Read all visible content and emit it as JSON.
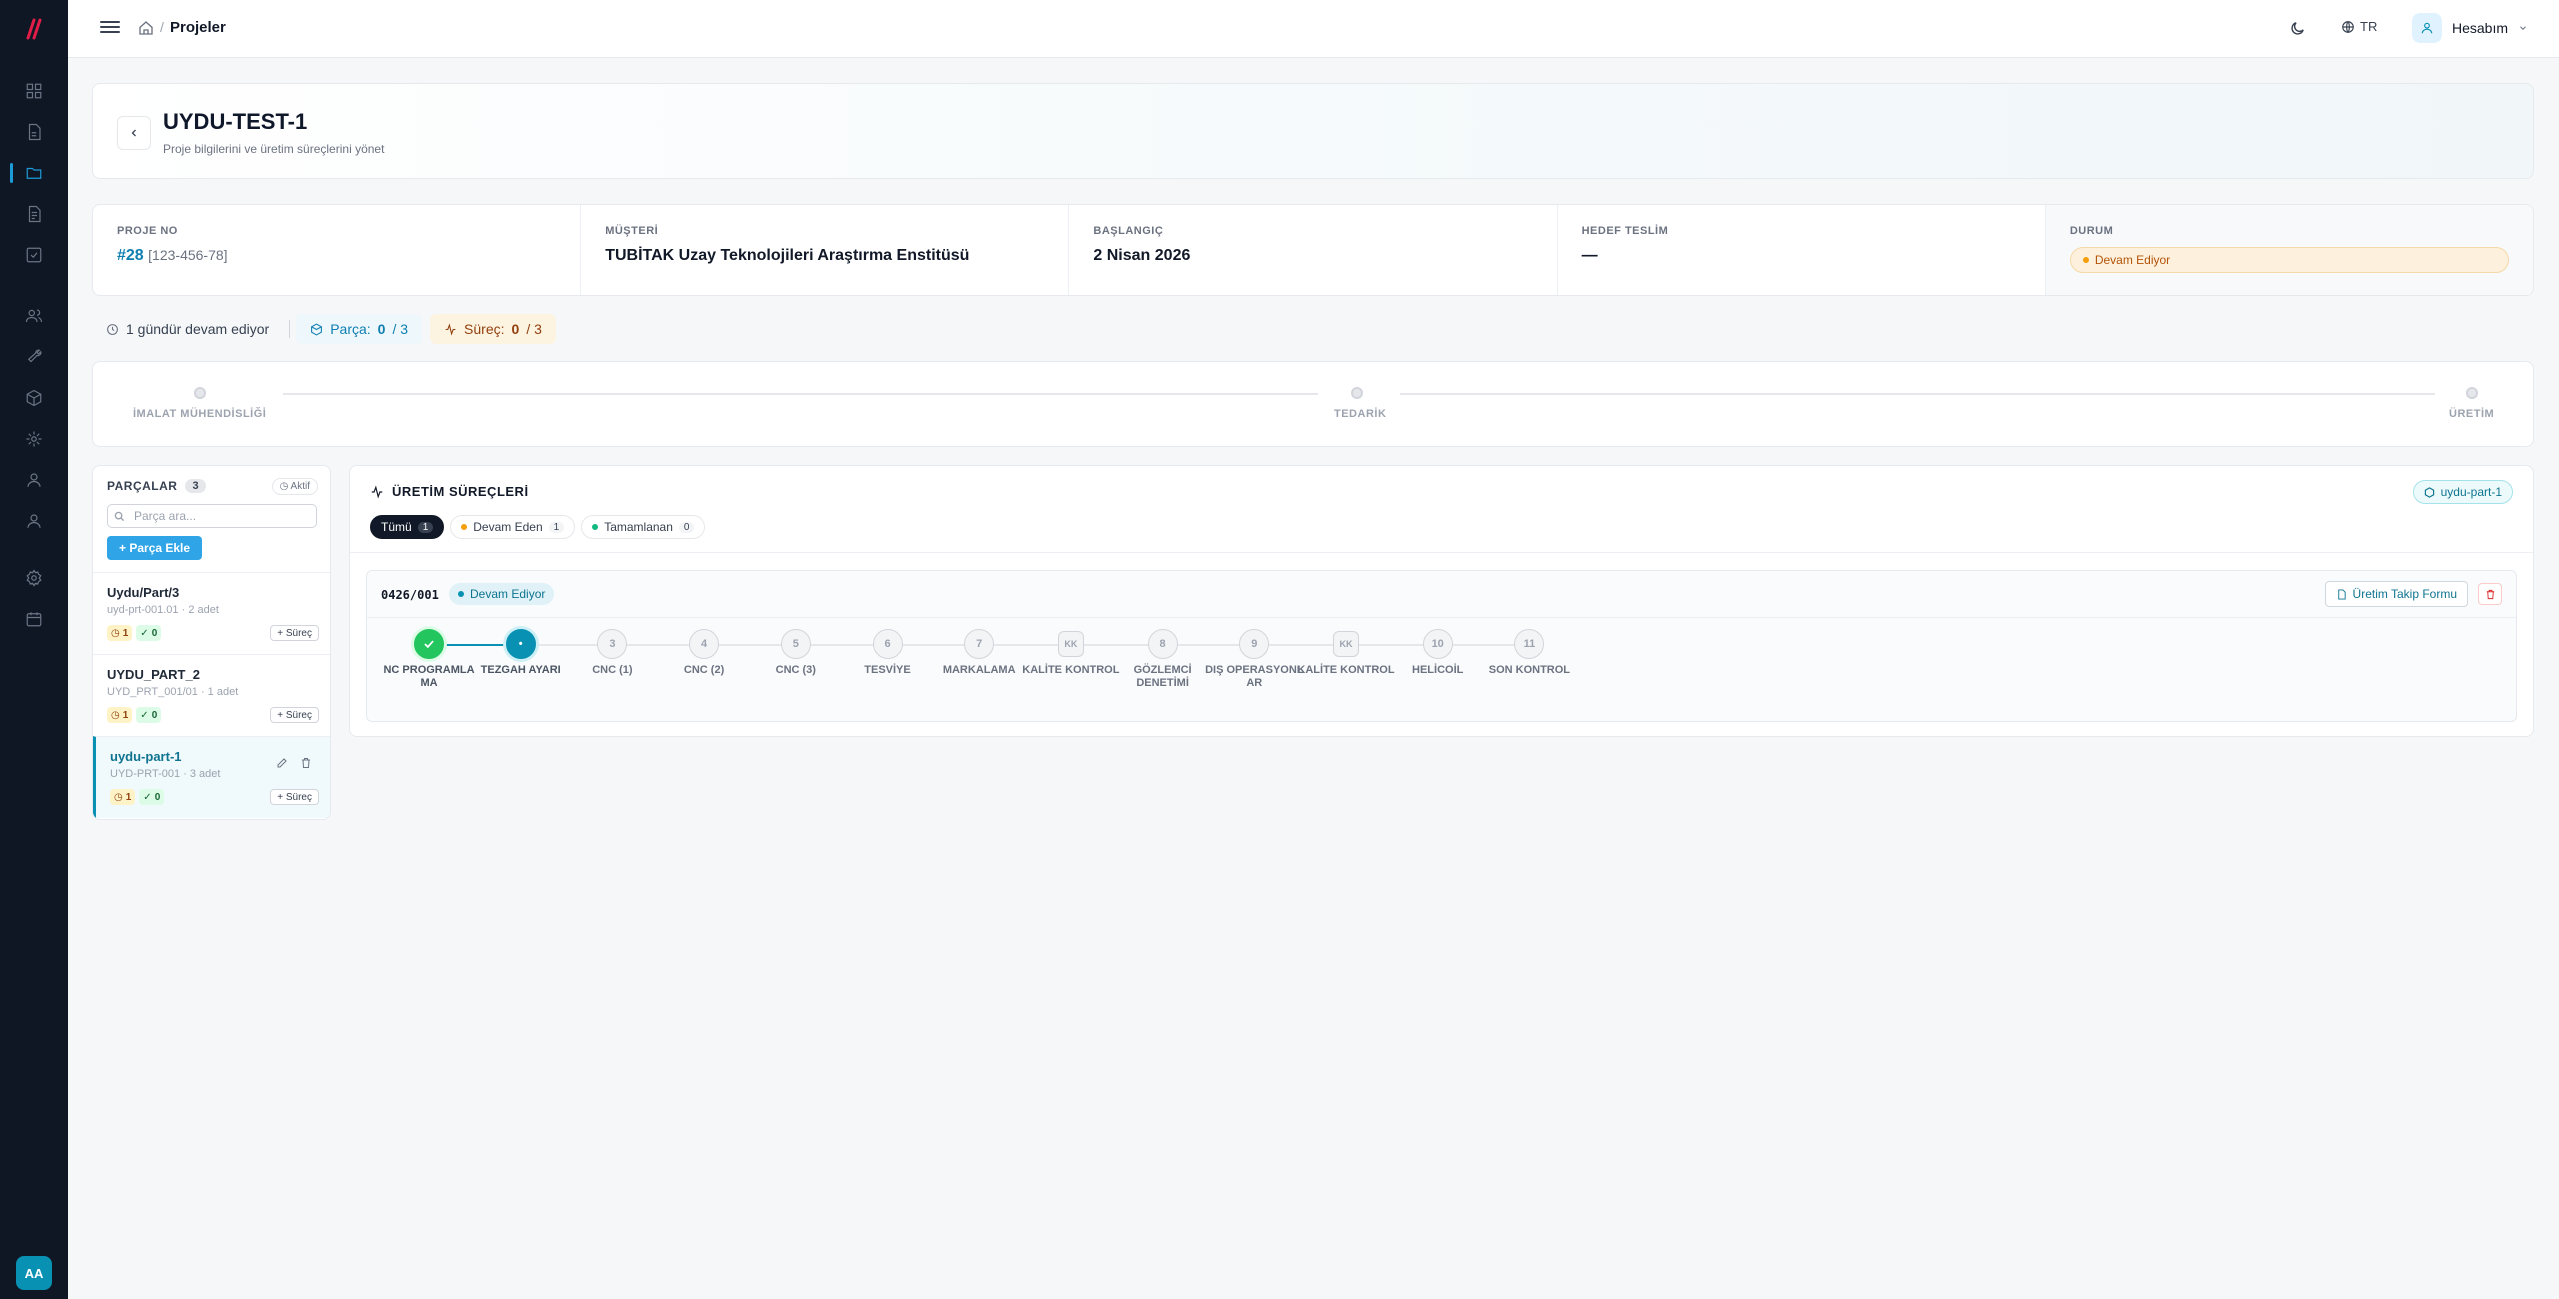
{
  "app": {
    "logo_text": "//",
    "user_initials": "AA"
  },
  "header": {
    "breadcrumb": "Projeler",
    "separator": "/",
    "language": "TR",
    "account": "Hesabım"
  },
  "project": {
    "title": "UYDU-TEST-1",
    "subtitle": "Proje bilgilerini ve üretim süreçlerini yönet",
    "info": {
      "no_label": "PROJE NO",
      "no_value": "#28",
      "no_code": "[123-456-78]",
      "customer_label": "MÜŞTERİ",
      "customer_value": "TUBİTAK Uzay Teknolojileri Araştırma Enstitüsü",
      "start_label": "BAŞLANGIÇ",
      "start_value": "2 Nisan 2026",
      "target_label": "HEDEF TESLİM",
      "target_value": "—",
      "status_label": "DURUM",
      "status_value": "Devam Ediyor"
    },
    "stats": {
      "duration": "1 gündür devam ediyor",
      "parts_label": "Parça:",
      "parts_value": "0",
      "parts_total": "/ 3",
      "process_label": "Süreç:",
      "process_value": "0",
      "process_total": "/ 3"
    },
    "phases": [
      "İMALAT MÜHENDİSLİĞİ",
      "TEDARİK",
      "ÜRETİM"
    ]
  },
  "parts": {
    "title": "PARÇALAR",
    "count": "3",
    "aktif": "Aktif",
    "search_placeholder": "Parça ara...",
    "add_label": "+ Parça Ekle",
    "surec_label": "+ Süreç",
    "items": [
      {
        "name": "Uydu/Part/3",
        "meta": "uyd-prt-001.01 · 2 adet",
        "pending": "1",
        "done": "0"
      },
      {
        "name": "UYDU_PART_2",
        "meta": "UYD_PRT_001/01 · 1 adet",
        "pending": "1",
        "done": "0"
      },
      {
        "name": "uydu-part-1",
        "meta": "UYD-PRT-001 · 3 adet",
        "pending": "1",
        "done": "0"
      }
    ]
  },
  "processes": {
    "title": "ÜRETİM SÜREÇLERİ",
    "selected_part": "uydu-part-1",
    "filters": [
      {
        "label": "Tümü",
        "count": "1"
      },
      {
        "label": "Devam Eden",
        "count": "1"
      },
      {
        "label": "Tamamlanan",
        "count": "0"
      }
    ],
    "work_order": {
      "no": "0426/001",
      "status": "Devam Ediyor",
      "form_button": "Üretim Takip Formu",
      "steps": [
        {
          "mark": "",
          "label": "NC PROGRAMLA MA",
          "state": "done"
        },
        {
          "mark": "•",
          "label": "TEZGAH AYARI",
          "state": "current"
        },
        {
          "mark": "3",
          "label": "CNC (1)",
          "state": "todo"
        },
        {
          "mark": "4",
          "label": "CNC (2)",
          "state": "todo"
        },
        {
          "mark": "5",
          "label": "CNC (3)",
          "state": "todo"
        },
        {
          "mark": "6",
          "label": "TESVİYE",
          "state": "todo"
        },
        {
          "mark": "7",
          "label": "MARKALAMA",
          "state": "todo"
        },
        {
          "mark": "KK",
          "label": "KALİTE KONTROL",
          "state": "kk"
        },
        {
          "mark": "8",
          "label": "GÖZLEMCİ DENETİMİ",
          "state": "todo"
        },
        {
          "mark": "9",
          "label": "DIŞ OPERASYONL AR",
          "state": "todo"
        },
        {
          "mark": "KK",
          "label": "KALİTE KONTROL",
          "state": "kk"
        },
        {
          "mark": "10",
          "label": "HELİCOİL",
          "state": "todo"
        },
        {
          "mark": "11",
          "label": "SON KONTROL",
          "state": "todo"
        }
      ]
    }
  },
  "colors": {
    "accent": "#0891b2",
    "sidebar": "#0f1724",
    "success": "#22c55e",
    "warning": "#b45309"
  }
}
